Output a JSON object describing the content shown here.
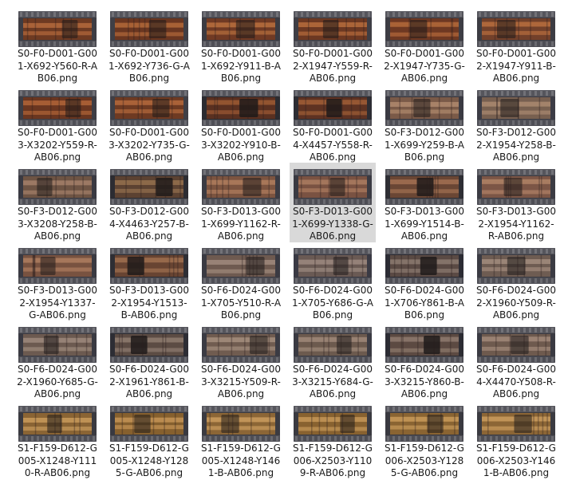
{
  "files": [
    {
      "name": "S0-F0-D001-G001-X692-Y560-R-AB06.png",
      "thumb": {
        "icon": "image-thumbnail-icon",
        "tone": "red",
        "palette": [
          "#6e3a22",
          "#b46a3c",
          "#3d3d44"
        ]
      }
    },
    {
      "name": "S0-F0-D001-G001-X692-Y736-G-AB06.png",
      "thumb": {
        "icon": "image-thumbnail-icon",
        "tone": "red",
        "palette": [
          "#6a3620",
          "#b2683a",
          "#3f3f46"
        ]
      }
    },
    {
      "name": "S0-F0-D001-G001-X692-Y911-B-AB06.png",
      "thumb": {
        "icon": "image-thumbnail-icon",
        "tone": "red",
        "palette": [
          "#703a24",
          "#b8703e",
          "#3b3b42"
        ]
      }
    },
    {
      "name": "S0-F0-D001-G002-X1947-Y559-R-AB06.png",
      "thumb": {
        "icon": "image-thumbnail-icon",
        "tone": "red",
        "palette": [
          "#6c3822",
          "#b66c3c",
          "#3e3e45"
        ]
      }
    },
    {
      "name": "S0-F0-D001-G002-X1947-Y735-G-AB06.png",
      "thumb": {
        "icon": "image-thumbnail-icon",
        "tone": "red",
        "palette": [
          "#6e3822",
          "#b46a3a",
          "#3d3d44"
        ]
      }
    },
    {
      "name": "S0-F0-D001-G002-X1947-Y911-B-AB06.png",
      "thumb": {
        "icon": "image-thumbnail-icon",
        "tone": "red",
        "palette": [
          "#72402a",
          "#b86e3e",
          "#3c3c43"
        ]
      }
    },
    {
      "name": "S0-F0-D001-G003-X3202-Y559-R-AB06.png",
      "thumb": {
        "icon": "image-thumbnail-icon",
        "tone": "red",
        "palette": [
          "#6a3620",
          "#b06438",
          "#3d3d44"
        ]
      }
    },
    {
      "name": "S0-F0-D001-G003-X3202-Y735-G-AB06.png",
      "thumb": {
        "icon": "image-thumbnail-icon",
        "tone": "red",
        "palette": [
          "#6e3a22",
          "#b46a3c",
          "#3f3f46"
        ]
      }
    },
    {
      "name": "S0-F0-D001-G003-X3202-Y910-B-AB06.png",
      "thumb": {
        "icon": "image-thumbnail-icon",
        "tone": "dark",
        "palette": [
          "#5a3020",
          "#9c5a34",
          "#2b2b30"
        ]
      }
    },
    {
      "name": "S0-F0-D001-G004-X4457-Y558-R-AB06.png",
      "thumb": {
        "icon": "image-thumbnail-icon",
        "tone": "dark",
        "palette": [
          "#5e3222",
          "#a05e36",
          "#2d2d33"
        ]
      }
    },
    {
      "name": "S0-F3-D012-G001-X699-Y259-B-AB06.png",
      "thumb": {
        "icon": "image-thumbnail-icon",
        "tone": "muted",
        "palette": [
          "#7a5a48",
          "#b08a6e",
          "#3a3a42"
        ]
      }
    },
    {
      "name": "S0-F3-D012-G002-X1954-Y258-B-AB06.png",
      "thumb": {
        "icon": "image-thumbnail-icon",
        "tone": "muted",
        "palette": [
          "#786050",
          "#aa8a70",
          "#3c3c45"
        ]
      }
    },
    {
      "name": "S0-F3-D012-G003-X3208-Y258-B-AB06.png",
      "thumb": {
        "icon": "image-thumbnail-icon",
        "tone": "muted",
        "palette": [
          "#6e5444",
          "#a4806a",
          "#3a3a42"
        ]
      }
    },
    {
      "name": "S0-F3-D012-G004-X4463-Y257-B-AB06.png",
      "thumb": {
        "icon": "image-thumbnail-icon",
        "tone": "dark",
        "palette": [
          "#5c4232",
          "#94704e",
          "#2c2c32"
        ]
      }
    },
    {
      "name": "S0-F3-D013-G001-X699-Y1162-R-AB06.png",
      "thumb": {
        "icon": "image-thumbnail-icon",
        "tone": "muted",
        "palette": [
          "#7c5440",
          "#b07e5e",
          "#3b3b43"
        ]
      }
    },
    {
      "name": "S0-F3-D013-G001-X699-Y1338-G-AB06.png",
      "thumb": {
        "icon": "image-thumbnail-icon",
        "tone": "muted",
        "palette": [
          "#7a5242",
          "#ac7c60",
          "#3a3a42"
        ]
      }
    },
    {
      "name": "S0-F3-D013-G001-X699-Y1514-B-AB06.png",
      "thumb": {
        "icon": "image-thumbnail-icon",
        "tone": "dark",
        "palette": [
          "#6a4634",
          "#a27052",
          "#2e2e34"
        ]
      }
    },
    {
      "name": "S0-F3-D013-G002-X1954-Y1162-R-AB06.png",
      "thumb": {
        "icon": "image-thumbnail-icon",
        "tone": "muted",
        "palette": [
          "#7c5646",
          "#b08266",
          "#3b3b43"
        ]
      }
    },
    {
      "name": "S0-F3-D013-G002-X1954-Y1337-G-AB06.png",
      "thumb": {
        "icon": "image-thumbnail-icon",
        "tone": "muted",
        "palette": [
          "#785240",
          "#ae7e60",
          "#3a3a42"
        ]
      }
    },
    {
      "name": "S0-F3-D013-G002-X1954-Y1513-B-AB06.png",
      "thumb": {
        "icon": "image-thumbnail-icon",
        "tone": "dark",
        "palette": [
          "#684432",
          "#a07050",
          "#2e2e34"
        ]
      }
    },
    {
      "name": "S0-F6-D024-G001-X705-Y510-R-AB06.png",
      "thumb": {
        "icon": "image-thumbnail-icon",
        "tone": "muted",
        "palette": [
          "#6e5a50",
          "#a08a7c",
          "#3a3a42"
        ]
      }
    },
    {
      "name": "S0-F6-D024-G001-X705-Y686-G-AB06.png",
      "thumb": {
        "icon": "image-thumbnail-icon",
        "tone": "muted",
        "palette": [
          "#6a5a54",
          "#9c8a80",
          "#3a3a44"
        ]
      }
    },
    {
      "name": "S0-F6-D024-G001-X706-Y861-B-AB06.png",
      "thumb": {
        "icon": "image-thumbnail-icon",
        "tone": "dark",
        "palette": [
          "#5a4a44",
          "#8c7a70",
          "#2c2c34"
        ]
      }
    },
    {
      "name": "S0-F6-D024-G002-X1960-Y509-R-AB06.png",
      "thumb": {
        "icon": "image-thumbnail-icon",
        "tone": "muted",
        "palette": [
          "#6e5c52",
          "#a28c7e",
          "#3b3b43"
        ]
      }
    },
    {
      "name": "S0-F6-D024-G002-X1960-Y685-G-AB06.png",
      "thumb": {
        "icon": "image-thumbnail-icon",
        "tone": "muted",
        "palette": [
          "#6c5a50",
          "#9e8a7c",
          "#3a3a42"
        ]
      }
    },
    {
      "name": "S0-F6-D024-G002-X1961-Y861-B-AB06.png",
      "thumb": {
        "icon": "image-thumbnail-icon",
        "tone": "dark",
        "palette": [
          "#5c4c44",
          "#8e7c70",
          "#2d2d34"
        ]
      }
    },
    {
      "name": "S0-F6-D024-G003-X3215-Y509-R-AB06.png",
      "thumb": {
        "icon": "image-thumbnail-icon",
        "tone": "muted",
        "palette": [
          "#705c50",
          "#a48e7e",
          "#3b3b43"
        ]
      }
    },
    {
      "name": "S0-F6-D024-G003-X3215-Y684-G-AB06.png",
      "thumb": {
        "icon": "image-thumbnail-icon",
        "tone": "muted",
        "palette": [
          "#6c5a4e",
          "#a08a7a",
          "#3a3a42"
        ]
      }
    },
    {
      "name": "S0-F6-D024-G003-X3215-Y860-B-AB06.png",
      "thumb": {
        "icon": "image-thumbnail-icon",
        "tone": "dark",
        "palette": [
          "#5c4a42",
          "#8e7a6e",
          "#2c2c33"
        ]
      }
    },
    {
      "name": "S0-F6-D024-G004-X4470-Y508-R-AB06.png",
      "thumb": {
        "icon": "image-thumbnail-icon",
        "tone": "muted",
        "palette": [
          "#6e5a4e",
          "#a28a7a",
          "#3a3a42"
        ]
      }
    },
    {
      "name": "S1-F159-D612-G005-X1248-Y1110-R-AB06.png",
      "thumb": {
        "icon": "image-thumbnail-icon",
        "tone": "gold",
        "palette": [
          "#8a6434",
          "#c89a5c",
          "#3a3a40"
        ]
      }
    },
    {
      "name": "S1-F159-D612-G005-X1248-Y1285-G-AB06.png",
      "thumb": {
        "icon": "image-thumbnail-icon",
        "tone": "gold",
        "palette": [
          "#86602e",
          "#c49456",
          "#393940"
        ]
      }
    },
    {
      "name": "S1-F159-D612-G005-X1248-Y1461-B-AB06.png",
      "thumb": {
        "icon": "image-thumbnail-icon",
        "tone": "gold",
        "palette": [
          "#8c6636",
          "#ca9c5e",
          "#3b3b41"
        ]
      }
    },
    {
      "name": "S1-F159-D612-G006-X2503-Y1109-R-AB06.png",
      "thumb": {
        "icon": "image-thumbnail-icon",
        "tone": "gold",
        "palette": [
          "#886230",
          "#c69858",
          "#3a3a40"
        ]
      }
    },
    {
      "name": "S1-F159-D612-G006-X2503-Y1285-G-AB06.png",
      "thumb": {
        "icon": "image-thumbnail-icon",
        "tone": "gold",
        "palette": [
          "#8a6432",
          "#c89a5a",
          "#393940"
        ]
      }
    },
    {
      "name": "S1-F159-D612-G006-X2503-Y1461-B-AB06.png",
      "thumb": {
        "icon": "image-thumbnail-icon",
        "tone": "gold",
        "palette": [
          "#8c6636",
          "#ca9c5e",
          "#3b3b41"
        ]
      }
    }
  ],
  "selected_file": "S0-F3-D013-G001-X699-Y1338-G-AB06.png",
  "colors": {
    "background": "#ffffff",
    "selection": "#d9d9d9",
    "text": "#1a1a1a"
  }
}
